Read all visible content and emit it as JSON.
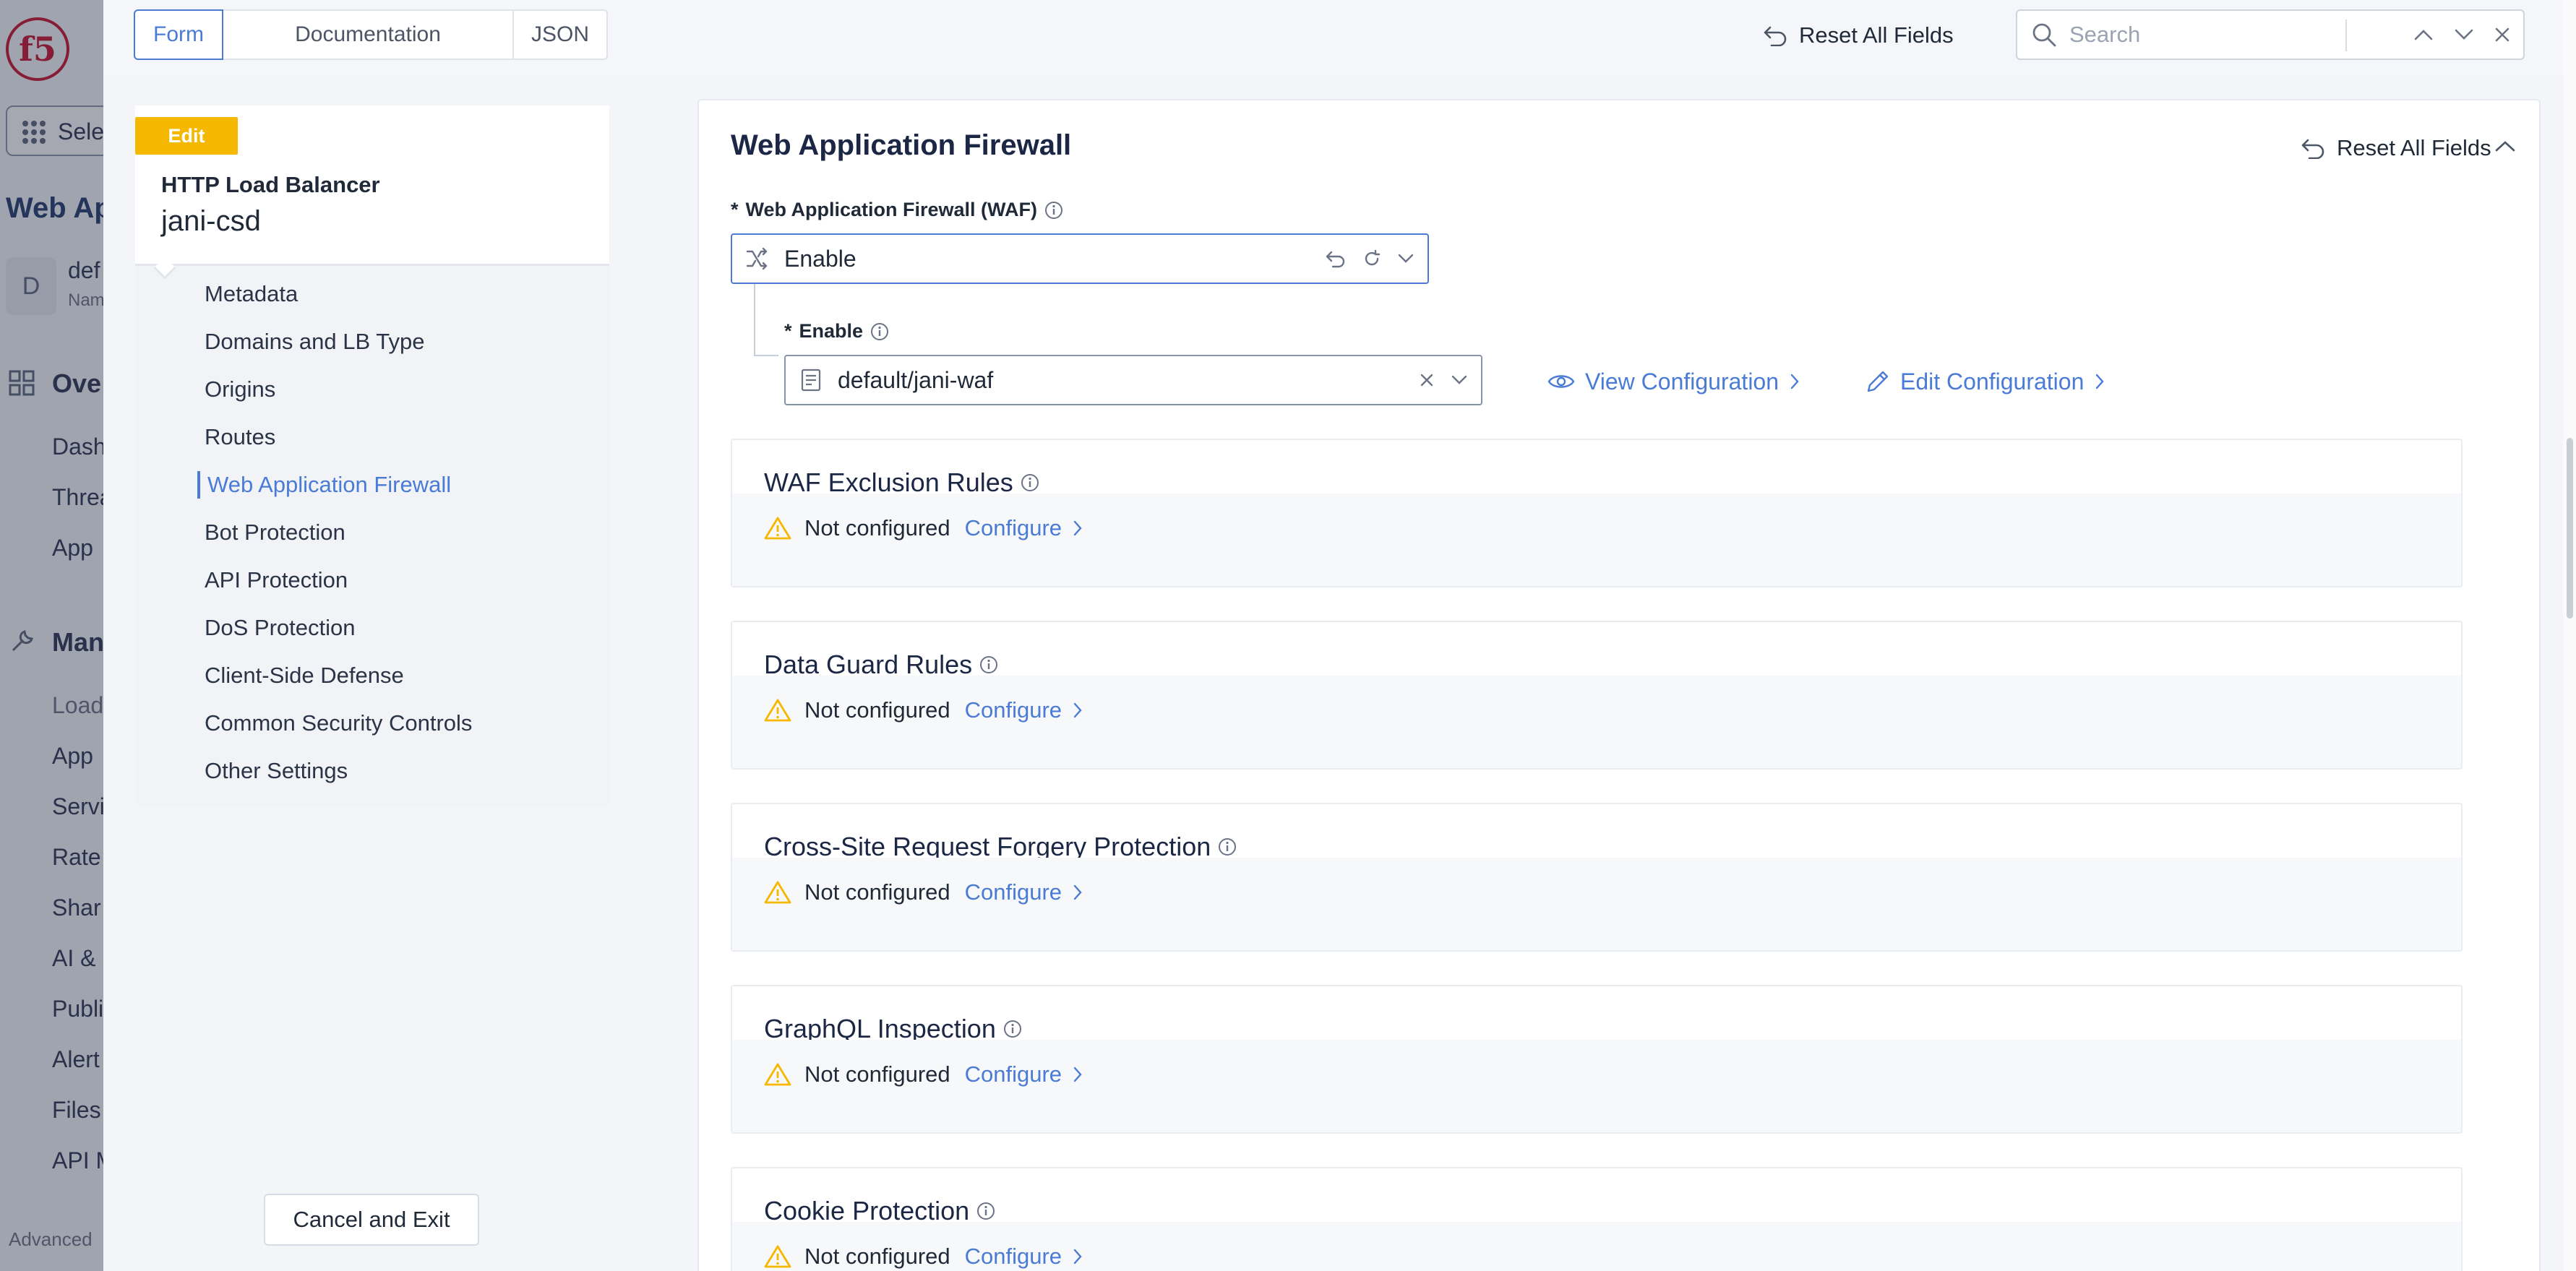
{
  "background_app": {
    "logo_text": "f5",
    "select_label": "Sele",
    "page_title": "Web Ap",
    "namespace_initial": "D",
    "namespace_name": "def",
    "namespace_sub": "Nam",
    "overview_section": "Ove",
    "overview_items": [
      "Dash",
      "Threa",
      "App"
    ],
    "manage_section": "Man",
    "manage_items": [
      "Load",
      "App",
      "Servi",
      "Rate",
      "Shar",
      "AI & I",
      "Publi",
      "Alert",
      "Files",
      "API M"
    ],
    "advanced_label": "Advanced"
  },
  "topbar": {
    "tabs": [
      {
        "label": "Form"
      },
      {
        "label": "Documentation"
      },
      {
        "label": "JSON"
      }
    ],
    "reset_label": "Reset All Fields",
    "search_placeholder": "Search"
  },
  "nav": {
    "badge": "Edit",
    "object_type": "HTTP Load Balancer",
    "object_name": "jani-csd",
    "items": [
      {
        "label": "Metadata"
      },
      {
        "label": "Domains and LB Type"
      },
      {
        "label": "Origins"
      },
      {
        "label": "Routes"
      },
      {
        "label": "Web Application Firewall"
      },
      {
        "label": "Bot Protection"
      },
      {
        "label": "API Protection"
      },
      {
        "label": "DoS Protection"
      },
      {
        "label": "Client-Side Defense"
      },
      {
        "label": "Common Security Controls"
      },
      {
        "label": "Other Settings"
      }
    ],
    "active_item": "Web Application Firewall",
    "cancel_label": "Cancel and Exit"
  },
  "main": {
    "section_title": "Web Application Firewall",
    "reset_label": "Reset All Fields",
    "waf_field": {
      "required_mark": "*",
      "label": "Web Application Firewall (WAF)",
      "value": "Enable"
    },
    "enable_field": {
      "required_mark": "*",
      "label": "Enable",
      "value": "default/jani-waf"
    },
    "view_config_label": "View Configuration",
    "edit_config_label": "Edit Configuration",
    "subsections": [
      {
        "title": "WAF Exclusion Rules",
        "status": "Not configured",
        "action": "Configure"
      },
      {
        "title": "Data Guard Rules",
        "status": "Not configured",
        "action": "Configure"
      },
      {
        "title": "Cross-Site Request Forgery Protection",
        "status": "Not configured",
        "action": "Configure"
      },
      {
        "title": "GraphQL Inspection",
        "status": "Not configured",
        "action": "Configure"
      },
      {
        "title": "Cookie Protection",
        "status": "Not configured",
        "action": "Configure"
      }
    ]
  },
  "colors": {
    "accent": "#4a7bd6",
    "badge": "#f5b800",
    "warning": "#f5b800",
    "brand_red": "#c8102e"
  }
}
